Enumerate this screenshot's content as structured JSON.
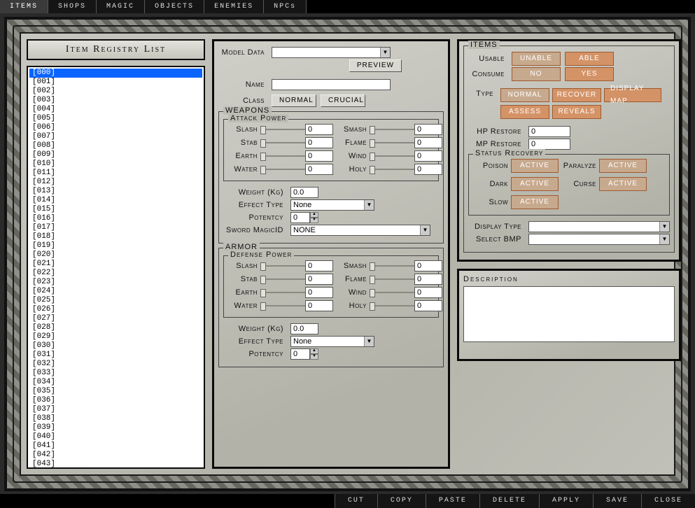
{
  "topTabs": [
    "ITEMS",
    "SHOPS",
    "MAGIC",
    "OBJECTS",
    "ENEMIES",
    "NPCs"
  ],
  "topActive": 0,
  "leftPanel": {
    "title": "Item Registry List",
    "selectedIndex": 0,
    "items": [
      "[000]",
      "[001]",
      "[002]",
      "[003]",
      "[004]",
      "[005]",
      "[006]",
      "[007]",
      "[008]",
      "[009]",
      "[010]",
      "[011]",
      "[012]",
      "[013]",
      "[014]",
      "[015]",
      "[016]",
      "[017]",
      "[018]",
      "[019]",
      "[020]",
      "[021]",
      "[022]",
      "[023]",
      "[024]",
      "[025]",
      "[026]",
      "[027]",
      "[028]",
      "[029]",
      "[030]",
      "[031]",
      "[032]",
      "[033]",
      "[034]",
      "[035]",
      "[036]",
      "[037]",
      "[038]",
      "[039]",
      "[040]",
      "[041]",
      "[042]",
      "[043]"
    ]
  },
  "center": {
    "modelData": {
      "label": "Model Data",
      "value": ""
    },
    "previewBtn": "PREVIEW",
    "name": {
      "label": "Name",
      "value": ""
    },
    "cls": {
      "label": "Class",
      "normal": "NORMAL",
      "crucial": "CRUCIAL"
    },
    "weapons": {
      "legend": "WEAPONS",
      "atkLegend": "Attack Power",
      "stats": {
        "slash": {
          "label": "Slash",
          "value": "0"
        },
        "stab": {
          "label": "Stab",
          "value": "0"
        },
        "earth": {
          "label": "Earth",
          "value": "0"
        },
        "water": {
          "label": "Water",
          "value": "0"
        },
        "smash": {
          "label": "Smash",
          "value": "0"
        },
        "flame": {
          "label": "Flame",
          "value": "0"
        },
        "wind": {
          "label": "Wind",
          "value": "0"
        },
        "holy": {
          "label": "Holy",
          "value": "0"
        }
      },
      "weight": {
        "label": "Weight (Kg)",
        "value": "0.0"
      },
      "effectType": {
        "label": "Effect Type",
        "value": "None"
      },
      "potency": {
        "label": "Potentcy",
        "value": "0"
      },
      "swordMagic": {
        "label": "Sword MagicID",
        "value": "NONE"
      }
    },
    "armor": {
      "legend": "ARMOR",
      "defLegend": "Defense Power",
      "stats": {
        "slash": {
          "label": "Slash",
          "value": "0"
        },
        "stab": {
          "label": "Stab",
          "value": "0"
        },
        "earth": {
          "label": "Earth",
          "value": "0"
        },
        "water": {
          "label": "Water",
          "value": "0"
        },
        "smash": {
          "label": "Smash",
          "value": "0"
        },
        "flame": {
          "label": "Flame",
          "value": "0"
        },
        "wind": {
          "label": "Wind",
          "value": "0"
        },
        "holy": {
          "label": "Holy",
          "value": "0"
        }
      },
      "weight": {
        "label": "Weight (Kg)",
        "value": "0.0"
      },
      "effectType": {
        "label": "Effect Type",
        "value": "None"
      },
      "potency": {
        "label": "Potentcy",
        "value": "0"
      }
    }
  },
  "items": {
    "legend": "ITEMS",
    "usable": {
      "label": "Usable",
      "unable": "UNABLE",
      "able": "ABLE"
    },
    "consume": {
      "label": "Consume",
      "no": "NO",
      "yes": "YES"
    },
    "type": {
      "label": "Type",
      "normal": "NORMAL",
      "recover": "RECOVER",
      "displayMap": "DISPLAY MAP",
      "assess": "ASSESS",
      "reveals": "REVEALS"
    },
    "hpRestore": {
      "label": "HP Restore",
      "value": "0"
    },
    "mpRestore": {
      "label": "MP Restore",
      "value": "0"
    },
    "statusRec": {
      "legend": "Status Recovery",
      "poison": {
        "label": "Poison",
        "btn": "ACTIVE"
      },
      "paralyze": {
        "label": "Paralyze",
        "btn": "ACTIVE"
      },
      "dark": {
        "label": "Dark",
        "btn": "ACTIVE"
      },
      "curse": {
        "label": "Curse",
        "btn": "ACTIVE"
      },
      "slow": {
        "label": "Slow",
        "btn": "ACTIVE"
      }
    },
    "displayType": {
      "label": "Display Type",
      "value": ""
    },
    "selectBmp": {
      "label": "Select BMP",
      "value": ""
    }
  },
  "desc": {
    "label": "Description",
    "value": ""
  },
  "bottomButtons": [
    "CUT",
    "COPY",
    "PASTE",
    "DELETE",
    "APPLY",
    "SAVE",
    "CLOSE"
  ]
}
